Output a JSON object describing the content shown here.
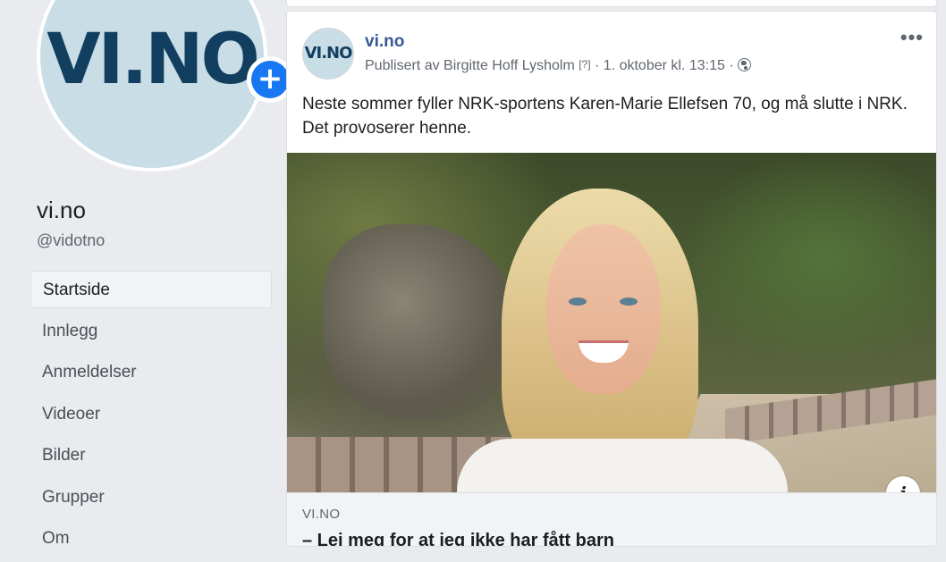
{
  "sidebar": {
    "logo_text": "VI.NO",
    "add_icon": "plus-icon",
    "page_name": "vi.no",
    "handle": "@vidotno",
    "items": [
      {
        "label": "Startside",
        "active": true
      },
      {
        "label": "Innlegg"
      },
      {
        "label": "Anmeldelser"
      },
      {
        "label": "Videoer"
      },
      {
        "label": "Bilder"
      },
      {
        "label": "Grupper"
      },
      {
        "label": "Om"
      }
    ]
  },
  "post": {
    "avatar_text": "VI.NO",
    "author": "vi.no",
    "published_by": "Publisert av Birgitte Hoff Lysholm",
    "help_mark": "[?]",
    "date": "1. oktober kl. 13:15",
    "separator": "·",
    "privacy_icon": "globe-icon",
    "more_icon": "•••",
    "text": "Neste sommer fyller NRK-sportens Karen-Marie Ellefsen 70, og må slutte i NRK. Det provoserer henne.",
    "info_icon": "i",
    "link": {
      "domain": "VI.NO",
      "title": "– Lei meg for at jeg ikke har fått barn"
    }
  },
  "colors": {
    "brand_link": "#385898",
    "add_button": "#1877f2",
    "logo_text": "#123f5f",
    "logo_bg": "#c9dde6"
  }
}
